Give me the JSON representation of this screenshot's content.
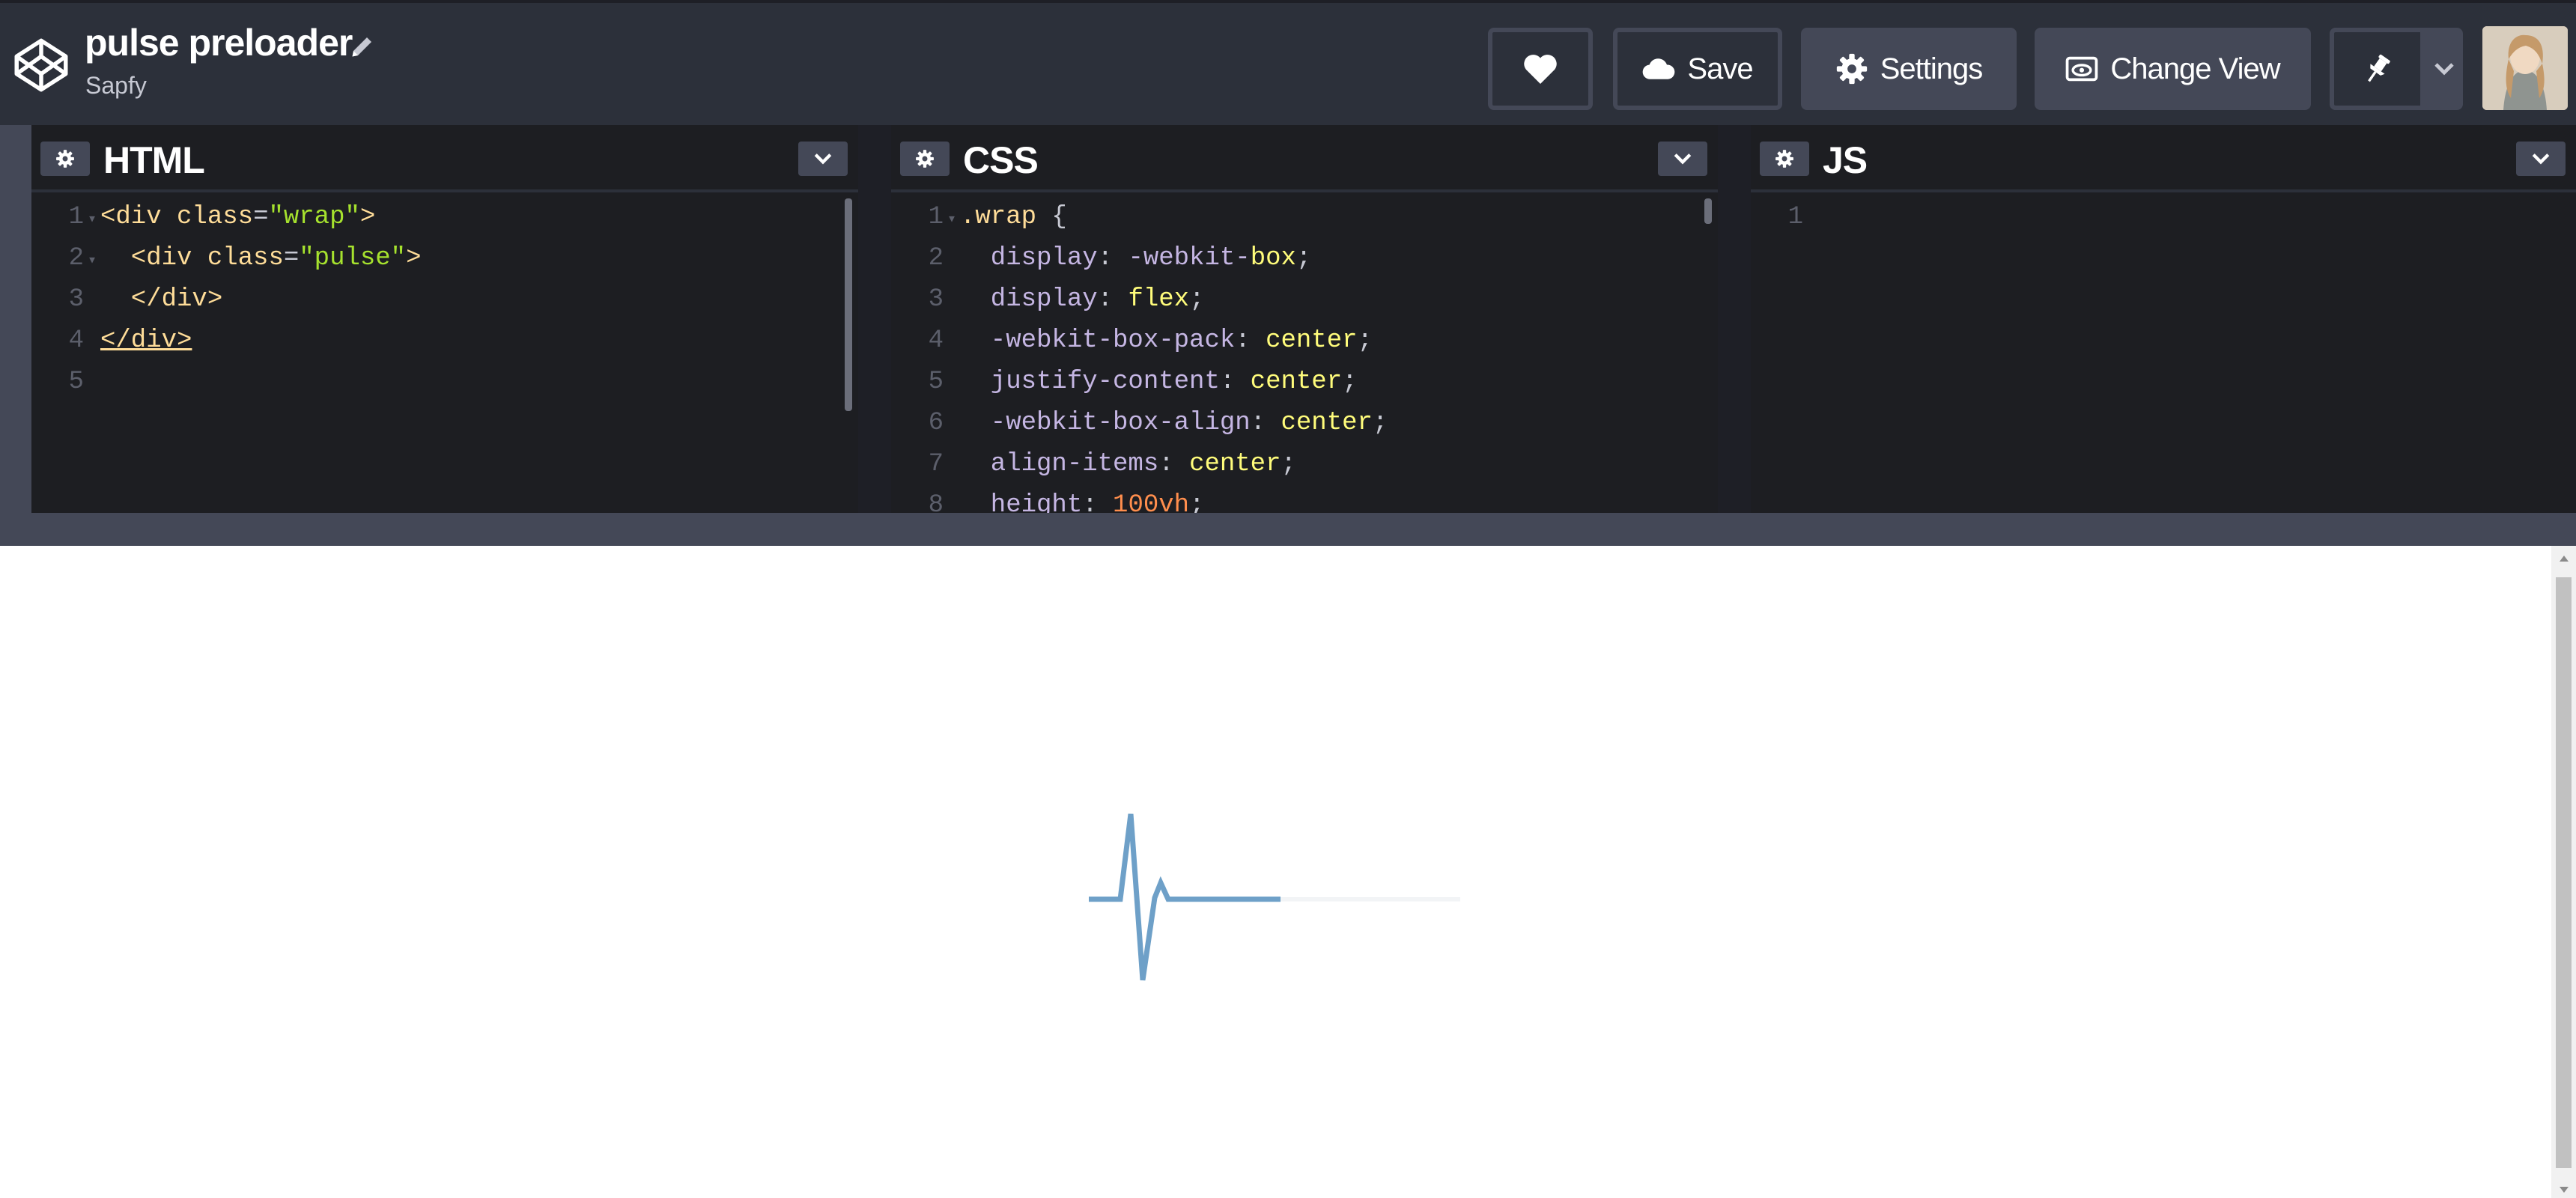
{
  "header": {
    "title": "pulse preloader",
    "author": "Sapfy",
    "buttons": {
      "save": "Save",
      "settings": "Settings",
      "change_view": "Change View"
    }
  },
  "panes": [
    {
      "title": "HTML"
    },
    {
      "title": "CSS"
    },
    {
      "title": "JS"
    }
  ],
  "html_code": [
    {
      "n": "1",
      "fold": true,
      "parts": [
        [
          "tag",
          "<div "
        ],
        [
          "attr",
          "class"
        ],
        [
          "eq",
          "="
        ],
        [
          "str",
          "\"wrap\""
        ],
        [
          "tag",
          ">"
        ]
      ]
    },
    {
      "n": "2",
      "fold": true,
      "parts": [
        [
          "tag",
          "  <div "
        ],
        [
          "attr",
          "class"
        ],
        [
          "eq",
          "="
        ],
        [
          "str",
          "\"pulse\""
        ],
        [
          "tag",
          ">"
        ]
      ]
    },
    {
      "n": "3",
      "fold": false,
      "parts": [
        [
          "tag",
          "  </div>"
        ]
      ]
    },
    {
      "n": "4",
      "fold": false,
      "parts": [
        [
          "close",
          "</div>"
        ]
      ]
    },
    {
      "n": "5",
      "fold": false,
      "parts": []
    }
  ],
  "css_code": [
    {
      "n": "1",
      "fold": true,
      "parts": [
        [
          "sel",
          ".wrap "
        ],
        [
          "punc",
          "{"
        ]
      ]
    },
    {
      "n": "2",
      "fold": false,
      "parts": [
        [
          "prop",
          "  display"
        ],
        [
          "punc",
          ": "
        ],
        [
          "prop",
          "-webkit-"
        ],
        [
          "val",
          "box"
        ],
        [
          "punc",
          ";"
        ]
      ]
    },
    {
      "n": "3",
      "fold": false,
      "parts": [
        [
          "prop",
          "  display"
        ],
        [
          "punc",
          ": "
        ],
        [
          "val",
          "flex"
        ],
        [
          "punc",
          ";"
        ]
      ]
    },
    {
      "n": "4",
      "fold": false,
      "parts": [
        [
          "prop",
          "  -webkit-box-pack"
        ],
        [
          "punc",
          ": "
        ],
        [
          "val",
          "center"
        ],
        [
          "punc",
          ";"
        ]
      ]
    },
    {
      "n": "5",
      "fold": false,
      "parts": [
        [
          "prop",
          "  justify-content"
        ],
        [
          "punc",
          ": "
        ],
        [
          "val",
          "center"
        ],
        [
          "punc",
          ";"
        ]
      ]
    },
    {
      "n": "6",
      "fold": false,
      "parts": [
        [
          "prop",
          "  -webkit-box-align"
        ],
        [
          "punc",
          ": "
        ],
        [
          "val",
          "center"
        ],
        [
          "punc",
          ";"
        ]
      ]
    },
    {
      "n": "7",
      "fold": false,
      "parts": [
        [
          "prop",
          "  align-items"
        ],
        [
          "punc",
          ": "
        ],
        [
          "val",
          "center"
        ],
        [
          "punc",
          ";"
        ]
      ]
    },
    {
      "n": "8",
      "fold": false,
      "parts": [
        [
          "prop",
          "  height"
        ],
        [
          "punc",
          ": "
        ],
        [
          "num",
          "100vh"
        ],
        [
          "punc",
          ";"
        ]
      ]
    }
  ],
  "js_code": [
    {
      "n": "1",
      "fold": false,
      "parts": []
    }
  ],
  "colors": {
    "header_bg": "#2c303a",
    "pane_bg": "#1d1e22",
    "button_bg": "#444857",
    "pulse_line": "#6ea0c8"
  }
}
